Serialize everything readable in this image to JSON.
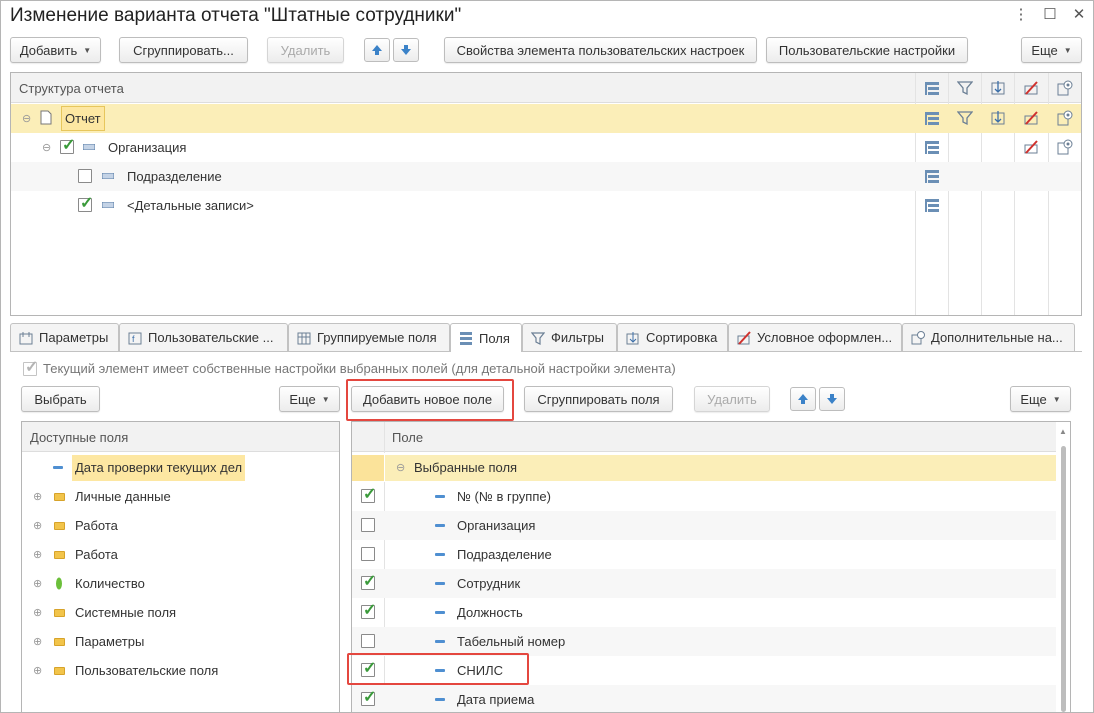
{
  "window": {
    "title": "Изменение варианта отчета \"Штатные сотрудники\"",
    "controls": [
      "⋮",
      "☐",
      "✕"
    ]
  },
  "toolbar": {
    "add": "Добавить",
    "group": "Сгруппировать...",
    "delete": "Удалить",
    "element_props": "Свойства элемента пользовательских настроек",
    "user_settings": "Пользовательские настройки",
    "more": "Еще"
  },
  "structure": {
    "header": "Структура отчета",
    "rows": [
      {
        "label": "Отчет"
      },
      {
        "label": "Организация"
      },
      {
        "label": "Подразделение"
      },
      {
        "label": "<Детальные записи>"
      }
    ]
  },
  "tabs": [
    {
      "label": "Параметры"
    },
    {
      "label": "Пользовательские ..."
    },
    {
      "label": "Группируемые поля"
    },
    {
      "label": "Поля"
    },
    {
      "label": "Фильтры"
    },
    {
      "label": "Сортировка"
    },
    {
      "label": "Условное оформлен..."
    },
    {
      "label": "Дополнительные на..."
    }
  ],
  "own_settings": {
    "label": "Текущий элемент имеет собственные настройки выбранных полей (для детальной настройки элемента)"
  },
  "left": {
    "select": "Выбрать",
    "more": "Еще",
    "header": "Доступные поля",
    "items": [
      {
        "label": "Дата проверки текущих дел"
      },
      {
        "label": "Личные данные"
      },
      {
        "label": "Работа"
      },
      {
        "label": "Работа"
      },
      {
        "label": "Количество"
      },
      {
        "label": "Системные поля"
      },
      {
        "label": "Параметры"
      },
      {
        "label": "Пользовательские поля"
      }
    ]
  },
  "right": {
    "add_field": "Добавить новое поле",
    "group_fields": "Сгруппировать поля",
    "delete": "Удалить",
    "more": "Еще",
    "header": "Поле",
    "group_label": "Выбранные поля",
    "fields": [
      {
        "label": "№ (№ в группе)",
        "checked": true
      },
      {
        "label": "Организация",
        "checked": false
      },
      {
        "label": "Подразделение",
        "checked": false
      },
      {
        "label": "Сотрудник",
        "checked": true
      },
      {
        "label": "Должность",
        "checked": true
      },
      {
        "label": "Табельный номер",
        "checked": false
      },
      {
        "label": "СНИЛС",
        "checked": true
      },
      {
        "label": "Дата приема",
        "checked": true
      }
    ]
  },
  "colors": {
    "selection": "#fbeeb8",
    "accent_highlight": "#e4473f",
    "check": "#3a9a3a"
  }
}
